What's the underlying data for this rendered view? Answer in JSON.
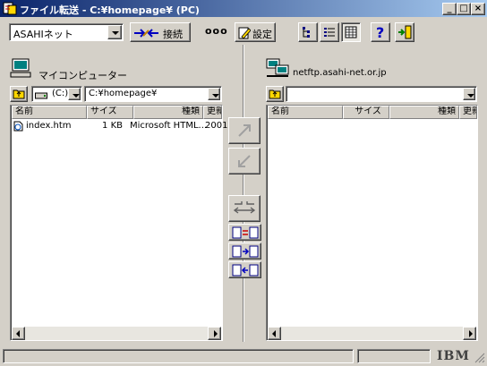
{
  "window": {
    "title": "ファイル転送 - C:¥homepage¥ (PC)"
  },
  "caption_buttons": {
    "minimize": "_",
    "maximize": "□",
    "close": "×"
  },
  "toolbar": {
    "site_select_value": "ASAHIネット",
    "connect_label": "接続",
    "more_label": "ooo",
    "settings_label": "設定"
  },
  "local": {
    "label": "マイコンピューター",
    "drive_value": "(C:)",
    "path_value": "C:¥homepage¥",
    "columns": [
      "名前",
      "サイズ",
      "種類",
      "更新"
    ],
    "files": [
      {
        "name": "index.htm",
        "size": "1 KB",
        "type": "Microsoft HTML...",
        "date": "2001"
      }
    ]
  },
  "remote": {
    "label": "netftp.asahi-net.or.jp",
    "path_value": "",
    "columns": [
      "名前",
      "サイズ",
      "種類",
      "更新"
    ],
    "files": []
  },
  "status": {
    "brand": "IBM"
  },
  "colors": {
    "titlebar_start": "#0a246a",
    "titlebar_end": "#a6caf0",
    "face": "#d4d0c8"
  }
}
